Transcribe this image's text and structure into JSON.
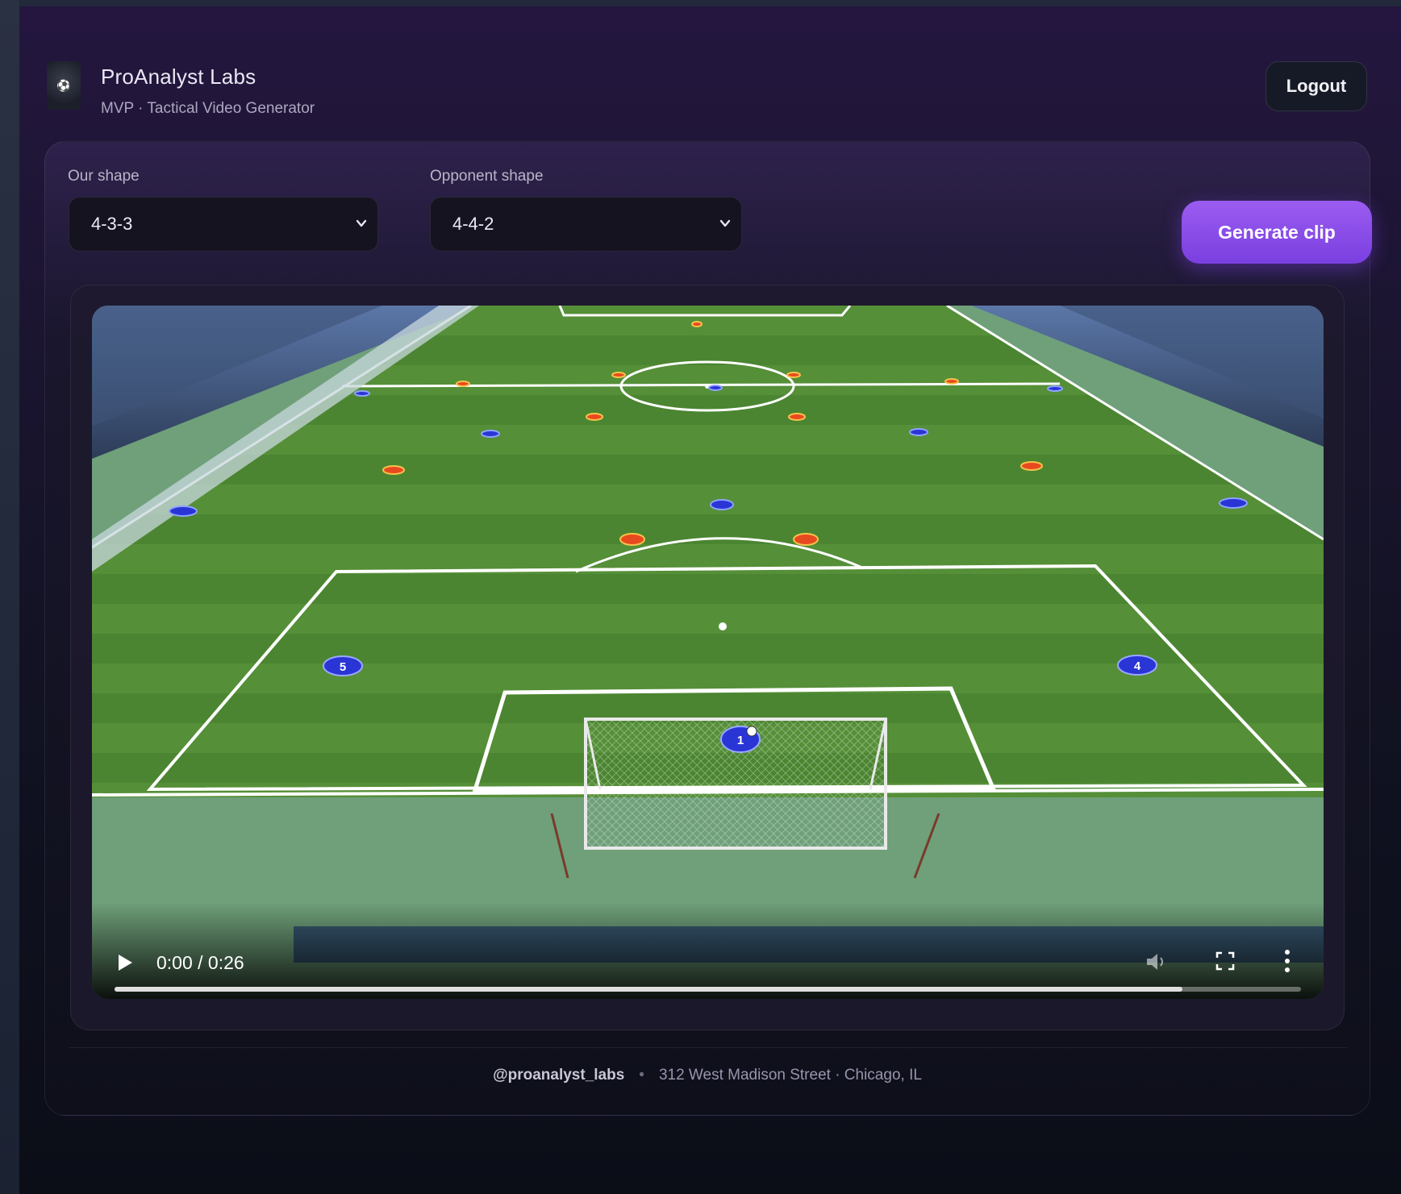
{
  "brand": {
    "title": "ProAnalyst Labs",
    "subtitle": "MVP · Tactical Video Generator"
  },
  "header": {
    "logout_label": "Logout"
  },
  "controls": {
    "our_shape": {
      "label": "Our shape",
      "value": "4-3-3"
    },
    "opponent_shape": {
      "label": "Opponent shape",
      "value": "4-4-2"
    },
    "generate_label": "Generate clip"
  },
  "video": {
    "timecode": "0:00 / 0:26",
    "progress_fraction": 0.9,
    "icons": {
      "play": "play-icon",
      "volume": "volume-icon",
      "fullscreen": "fullscreen-icon",
      "more": "more-vertical-icon"
    },
    "player_numbers": [
      "5",
      "4",
      "1"
    ]
  },
  "footer": {
    "handle": "@proanalyst_labs",
    "separator": "•",
    "address": "312 West Madison Street · Chicago, IL"
  },
  "colors": {
    "accent": "#8a4ff0",
    "our_team": "#2a35d6",
    "opponent_team": "#e84a20",
    "pitch": "#4e8a35"
  }
}
